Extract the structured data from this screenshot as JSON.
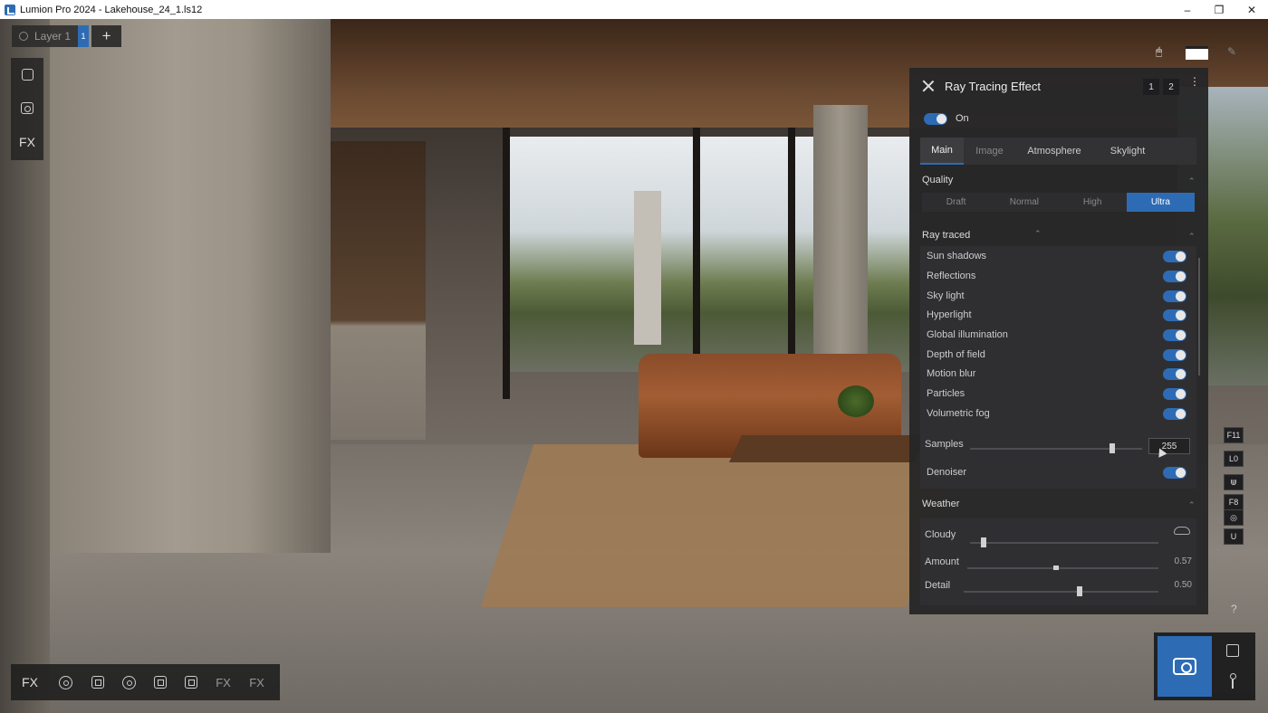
{
  "window": {
    "title": "Lumion Pro 2024 - Lakehouse_24_1.ls12",
    "minimize": "–",
    "maximize": "❐",
    "close": "✕"
  },
  "layers": {
    "label": "Layer 1",
    "badge": "1",
    "add": "+"
  },
  "left_rail": {
    "fx_label": "FX"
  },
  "panel": {
    "title": "Ray Tracing Effect",
    "btn1": "1",
    "btn2": "2",
    "kebab": "⋮",
    "on_label": "On",
    "tabs": [
      {
        "label": "Main"
      },
      {
        "label": "Image"
      },
      {
        "label": "Atmosphere"
      },
      {
        "label": "Skylight"
      }
    ],
    "quality": {
      "title": "Quality",
      "options": [
        "Draft",
        "Normal",
        "High",
        "Ultra"
      ],
      "selected": "Ultra"
    },
    "ray_traced": {
      "title": "Ray traced",
      "rows": [
        {
          "label": "Sun shadows",
          "on": true
        },
        {
          "label": "Reflections",
          "on": true
        },
        {
          "label": "Sky light",
          "on": true
        },
        {
          "label": "Hyperlight",
          "on": true
        },
        {
          "label": "Global illumination",
          "on": true
        },
        {
          "label": "Depth of field",
          "on": true
        },
        {
          "label": "Motion blur",
          "on": true
        },
        {
          "label": "Particles",
          "on": true
        },
        {
          "label": "Volumetric fog",
          "on": true
        }
      ],
      "samples_label": "Samples",
      "samples_value": "255",
      "denoiser_label": "Denoiser"
    },
    "weather": {
      "title": "Weather",
      "cloudy_label": "Cloudy",
      "amount_label": "Amount",
      "amount_value": "0.57",
      "detail_label": "Detail",
      "detail_value": "0.50"
    },
    "caret_up": "⌃"
  },
  "right_rail": [
    "F11",
    "L0",
    "F8",
    "U"
  ],
  "help": "?",
  "bottom_bar": {
    "fx_left": "FX",
    "fx_a": "FX",
    "fx_b": "FX"
  },
  "colors": {
    "accent": "#2d6cb5",
    "panel_bg": "#262628"
  }
}
